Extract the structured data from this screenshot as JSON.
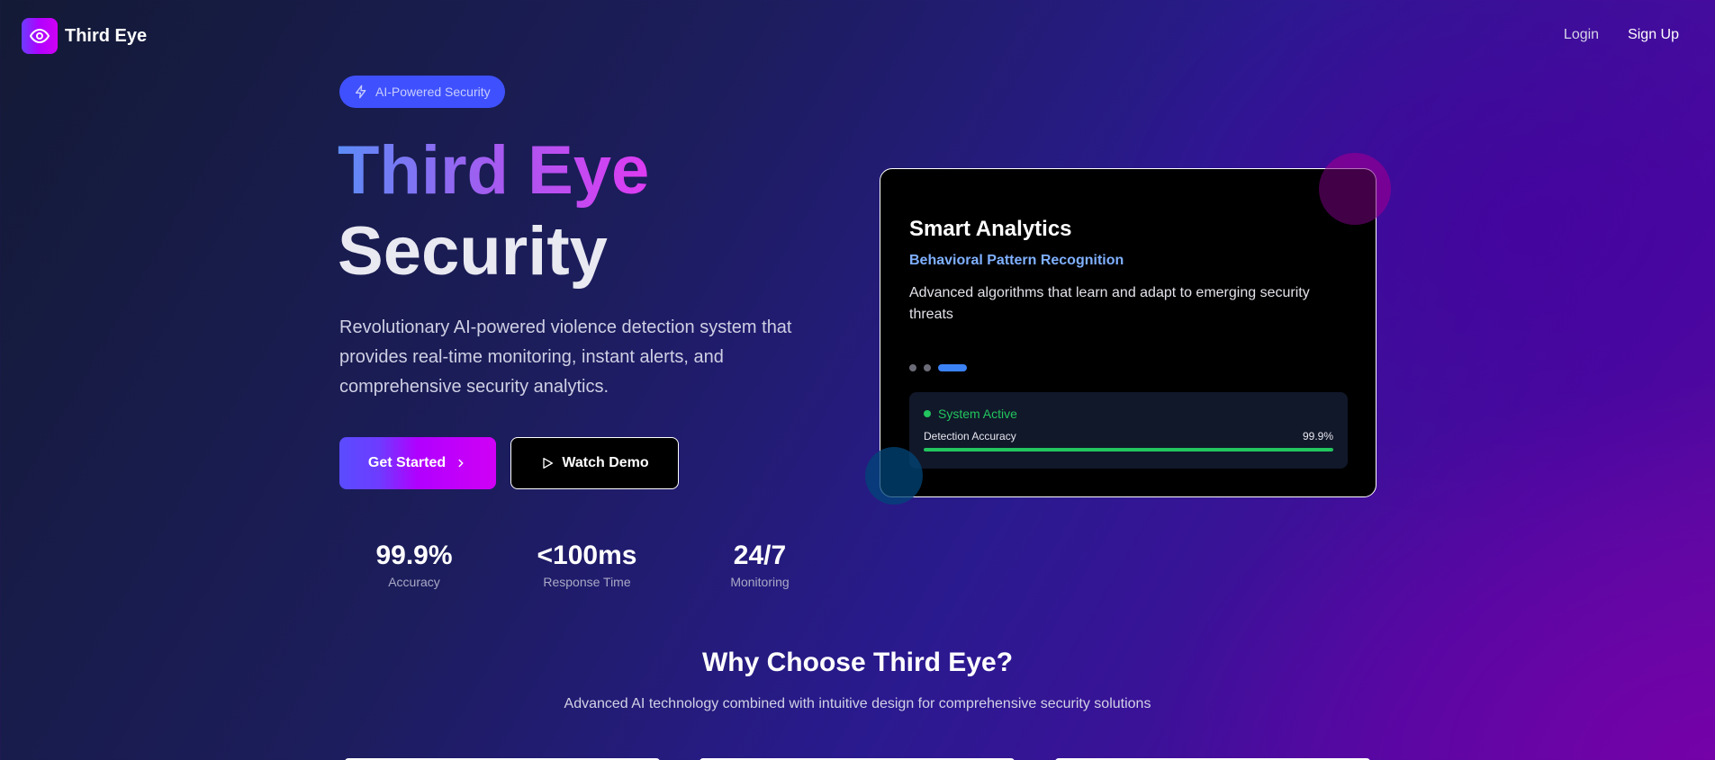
{
  "header": {
    "brand": "Third Eye",
    "nav": {
      "login": "Login",
      "signup": "Sign Up"
    }
  },
  "hero": {
    "badge": "AI-Powered Security",
    "title_line1": "Third Eye",
    "title_line2": "Security",
    "description": "Revolutionary AI-powered violence detection system that provides real-time monitoring, instant alerts, and comprehensive security analytics.",
    "cta_primary": "Get Started",
    "cta_secondary": "Watch Demo",
    "stats": [
      {
        "value": "99.9%",
        "label": "Accuracy"
      },
      {
        "value": "<100ms",
        "label": "Response Time"
      },
      {
        "value": "24/7",
        "label": "Monitoring"
      }
    ]
  },
  "feature_card": {
    "title": "Smart Analytics",
    "subtitle": "Behavioral Pattern Recognition",
    "description": "Advanced algorithms that learn and adapt to emerging security threats",
    "carousel_active_index": 2,
    "carousel_count": 3,
    "status": "System Active",
    "accuracy_label": "Detection Accuracy",
    "accuracy_value": "99.9%",
    "accuracy_fraction": 0.999
  },
  "section": {
    "title": "Why Choose Third Eye?",
    "subtitle": "Advanced AI technology combined with intuitive design for comprehensive security solutions"
  },
  "icons": {
    "logo": "eye-icon",
    "badge": "lightning-icon",
    "primary_cta": "chevron-right-icon",
    "secondary_cta": "play-icon"
  },
  "colors": {
    "brand_gradient_start": "#6d3cff",
    "brand_gradient_end": "#d000f5",
    "badge_bg": "#3f51ff",
    "subtitle_blue": "#7fb0ff",
    "status_green": "#22c55e",
    "carousel_active": "#3b82f6"
  }
}
